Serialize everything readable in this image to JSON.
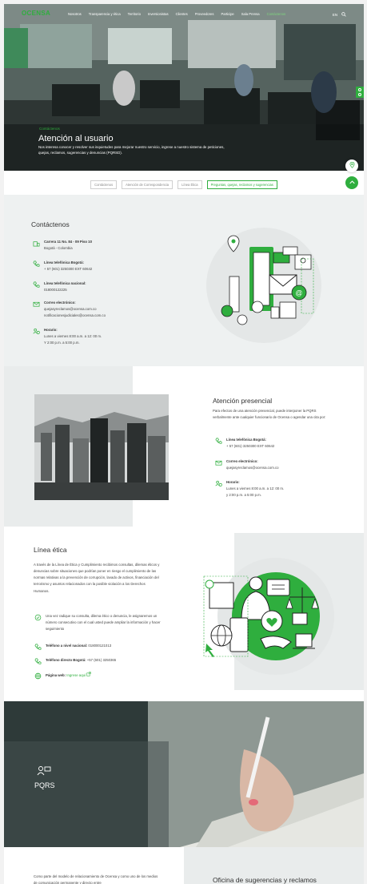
{
  "brand": {
    "logo": "OCENSA",
    "accent": "#2fae3e"
  },
  "nav": {
    "items": [
      "Nosotros",
      "Transparencia y ética",
      "Territorio",
      "Inversionistas",
      "Clientes",
      "Proveedores",
      "Participe",
      "Sala Prensa",
      "Contáctenos"
    ],
    "lang": "EN"
  },
  "hero": {
    "kicker": "Contáctenos",
    "title": "Atención al usuario",
    "text": "Nos interesa conocer y resolver sus inquietudes para mejorar nuestro servicio, ingrese a nuestro sistema de peticiones, quejas, reclamos, sugerencias y denuncias (PQRSD)."
  },
  "tabs": [
    "Contáctenos",
    "Atención de Correspondencia",
    "Línea Ética",
    "Preguntas, quejas, reclamos y sugerencias"
  ],
  "contact": {
    "title": "Contáctenos",
    "address_1": "Carrera 11 No. 84 - 09 Piso 10",
    "address_2": "Bogotá - Colombia",
    "phone_bog_label": "Línea telefónica Bogotá:",
    "phone_bog": "+ 57 (601) 3250300 EXT 60642",
    "phone_nat_label": "Línea telefónica nacional:",
    "phone_nat": "018000122225",
    "email_label": "Correo electrónico:",
    "email_1": "quejasyreclamos@ocensa.com.co",
    "email_2": "notificacionesjudiciales@ocensa.com.co",
    "hours_label": "Horario:",
    "hours_1": "Lunes a viernes 8:00 a.m. a 12: 00 m.",
    "hours_2": "Y 2:00 p.m. a 5:00 p.m."
  },
  "presencial": {
    "title": "Atención presencial",
    "text": "Para efectos de una atención presencial, puede interponer la PQRS verbalmente ante cualquier funcionario de Ocensa o agendar una cita por:",
    "phone_label": "Línea telefónica Bogotá:",
    "phone": "+ 57 (601) 3250300 EXT 60642",
    "email_label": "Correo electrónico:",
    "email": "quejasyreclamos@ocensa.com.co",
    "hours_label": "Horario:",
    "hours_1": "Lunes a viernes 8:00 a.m. a 12: 00 m.",
    "hours_2": "y 2:00 p.m. a 5:00 p.m."
  },
  "etica": {
    "title": "Línea ética",
    "text": "A través de la Línea de Ética y Cumplimiento recibimos consultas, dilemas éticos y denuncias sobre situaciones que podrían poner en riesgo el cumplimiento de las normas relativas a la prevención de corrupción, lavado de activos, financiación del terrorismo y asuntos relacionados con la posible violación a los Derechos Humanos.",
    "privacy": "Una vez radique su consulta, dilema ético o denuncia, le asignaremos un número consecutivo con el cual usted puede ampliar la información y hacer seguimiento",
    "phone_nat_label": "Teléfono a nivel nacional:",
    "phone_nat": "018000121013",
    "phone_bog_label": "Teléfono directo Bogotá:",
    "phone_bog": "+57 (601) 3250365",
    "web_label": "Página web:",
    "web_link": "Ingrese aquí"
  },
  "pqrs": {
    "label": "PQRS"
  },
  "bottom": {
    "text": "Como parte del modelo de relacionamiento de Ocensa y como uno de los medios de comunicación permanente y directo entre",
    "title": "Oficina de sugerencias y reclamos"
  }
}
